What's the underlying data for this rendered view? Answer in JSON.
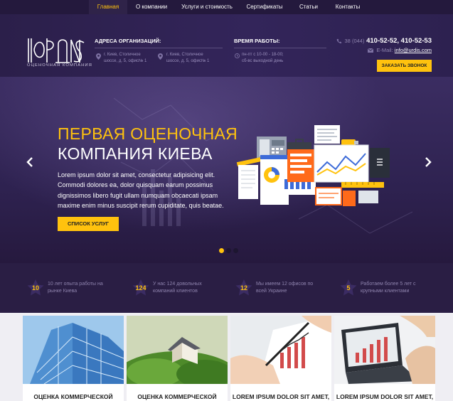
{
  "nav": {
    "items": [
      {
        "label": "Главная",
        "active": true
      },
      {
        "label": "О компании",
        "active": false
      },
      {
        "label": "Услуги и стоимость",
        "active": false
      },
      {
        "label": "Сертификаты",
        "active": false
      },
      {
        "label": "Статьи",
        "active": false
      },
      {
        "label": "Контакты",
        "active": false
      }
    ]
  },
  "header": {
    "logo_text": "ЮРДИС",
    "logo_subtitle": "ОЦЕНОЧНАЯ КОМПАНИЯ",
    "addresses_title": "АДРЕСА ОРГАНИЗАЦИЙ:",
    "address1_line1": "г. Киев, Столичное",
    "address1_line2": "шоссе, д. 5, офис№ 1",
    "address2_line1": "г. Киев, Столичное",
    "address2_line2": "шоссе, д. 5, офис№ 1",
    "hours_title": "ВРЕМЯ РАБОТЫ:",
    "hours_line1": "пн-пт с 10-00 - 18-00;",
    "hours_line2": "сб-вс выходной день",
    "phone_code": "38 (044)",
    "phone_numbers": "410-52-52, 410-52-53",
    "email_label": "E-Mail:",
    "email": "info@urdis.com",
    "callback_label": "ЗАКАЗАТЬ ЗВОНОК"
  },
  "hero": {
    "title_line1": "ПЕРВАЯ ОЦЕНОЧНАЯ",
    "title_line2": "КОМПАНИЯ КИЕВА",
    "text": "Lorem ipsum dolor sit amet, consectetur adipisicing elit. Commodi dolores ea, dolor quisquam earum possimus dignissimos libero fugit ullam numquam obcaecati ipsam maxime enim minus suscipit rerum cupiditate, quis beatae.",
    "button_label": "СПИСОК УСЛУГ",
    "slides_total": 3,
    "slide_active": 1
  },
  "stats": [
    {
      "number": "10",
      "text": "10 лет опыта работы на рынке Киева"
    },
    {
      "number": "124",
      "text": "У нас 124 довольных компаний клиентов"
    },
    {
      "number": "12",
      "text": "Мы имеем 12 офисов по всей Украине"
    },
    {
      "number": "5",
      "text": "Работаем более 5 лет с крупными клиентами"
    }
  ],
  "cards": [
    {
      "title": "ОЦЕНКА КОММЕРЧЕСКОЙ",
      "image": "glass-building"
    },
    {
      "title": "ОЦЕНКА КОММЕРЧЕСКОЙ",
      "image": "house-on-grass"
    },
    {
      "title": "LOREM IPSUM DOLOR SIT AMET,",
      "image": "hand-with-chart"
    },
    {
      "title": "LOREM IPSUM DOLOR SIT AMET,",
      "image": "laptop-chart"
    }
  ],
  "colors": {
    "accent": "#ffc20e",
    "nav_bg": "#24193d",
    "header_bg": "#2b1f4a",
    "stats_bg": "#2a1e44",
    "muted_text": "#8e83ad"
  }
}
